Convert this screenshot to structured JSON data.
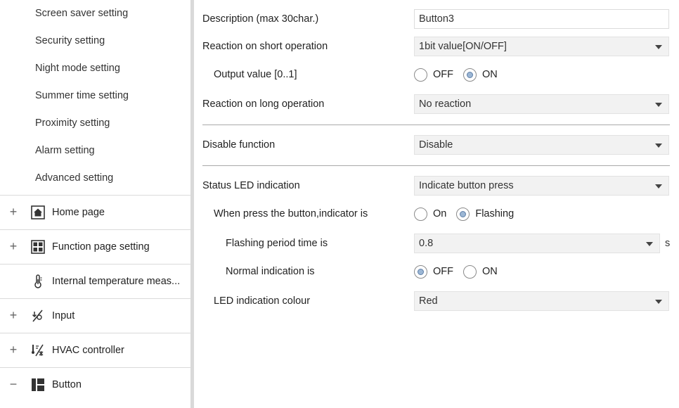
{
  "sidebar": {
    "sub_items": [
      "Screen saver setting",
      "Security setting",
      "Night mode setting",
      "Summer time setting",
      "Proximity setting",
      "Alarm setting",
      "Advanced setting"
    ],
    "tree_items": [
      {
        "label": "Home page",
        "toggle": "+",
        "icon": "home-icon"
      },
      {
        "label": "Function page setting",
        "toggle": "+",
        "icon": "grid-icon"
      },
      {
        "label": "Internal temperature meas...",
        "toggle": "",
        "icon": "thermometer-icon"
      },
      {
        "label": "Input",
        "toggle": "+",
        "icon": "input-icon"
      },
      {
        "label": "HVAC controller",
        "toggle": "+",
        "icon": "hvac-icon"
      },
      {
        "label": "Button",
        "toggle": "−",
        "icon": "layout-icon"
      }
    ]
  },
  "form": {
    "description": {
      "label": "Description (max 30char.)",
      "value": "Button3"
    },
    "short_operation": {
      "label": "Reaction on short operation",
      "value": "1bit value[ON/OFF]"
    },
    "output_value": {
      "label": "Output value [0..1]",
      "options": [
        "OFF",
        "ON"
      ],
      "selected": "ON"
    },
    "long_operation": {
      "label": "Reaction on long operation",
      "value": "No reaction"
    },
    "disable_function": {
      "label": "Disable function",
      "value": "Disable"
    },
    "status_led": {
      "label": "Status LED indication",
      "value": "Indicate button press"
    },
    "press_indicator": {
      "label": "When press the button,indicator is",
      "options": [
        "On",
        "Flashing"
      ],
      "selected": "Flashing"
    },
    "flashing_period": {
      "label": "Flashing period time is",
      "value": "0.8",
      "unit": "s"
    },
    "normal_indication": {
      "label": "Normal indication is",
      "options": [
        "OFF",
        "ON"
      ],
      "selected": "OFF"
    },
    "led_colour": {
      "label": "LED indication colour",
      "value": "Red"
    }
  }
}
